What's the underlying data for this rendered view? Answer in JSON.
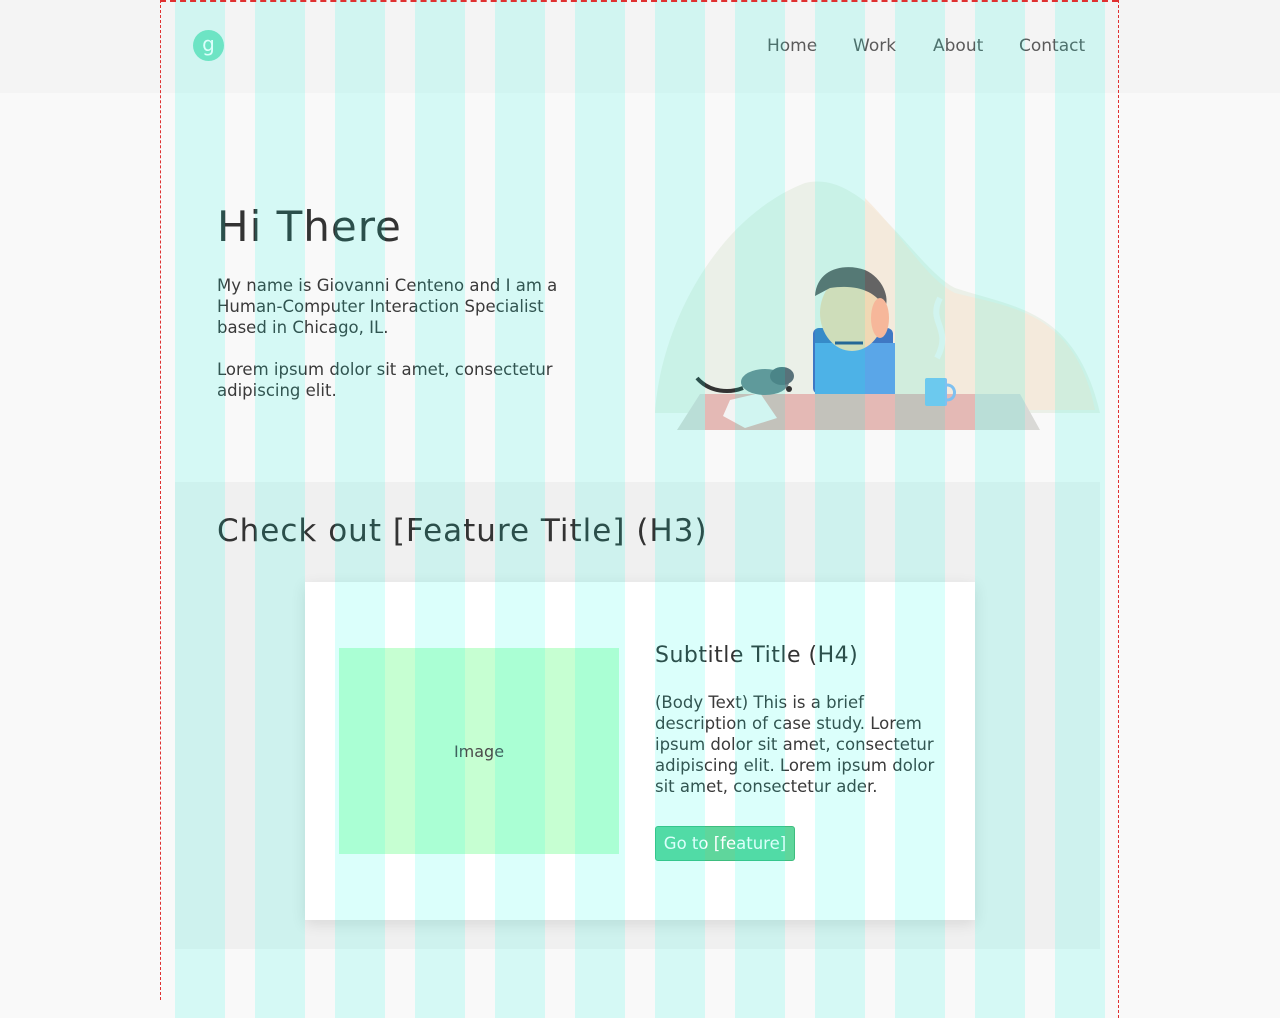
{
  "header": {
    "logo_letter": "g",
    "nav": [
      "Home",
      "Work",
      "About",
      "Contact"
    ]
  },
  "hero": {
    "title": "Hi There",
    "paragraph1": "My name is Giovanni Centeno and I am a Human-Computer Interaction Specialist based in Chicago, IL.",
    "paragraph2": "Lorem ipsum dolor sit amet, consectetur adipiscing elit."
  },
  "feature": {
    "title": "Check out [Feature Title] (H3)",
    "image_label": "Image",
    "subtitle": "Subtitle Title (H4)",
    "body": "(Body Text) This is a brief description of case study. Lorem ipsum dolor sit amet, consectetur adipiscing elit. Lorem ipsum dolor sit amet, consectetur ader.",
    "button_label": "Go to [feature]"
  },
  "colors": {
    "accent_green": "#5fd69c",
    "logo_mint": "#7fe0bf",
    "image_placeholder": "#c6ffd2",
    "grid_overlay": "#00ffe6",
    "guide_red": "#e03030"
  }
}
